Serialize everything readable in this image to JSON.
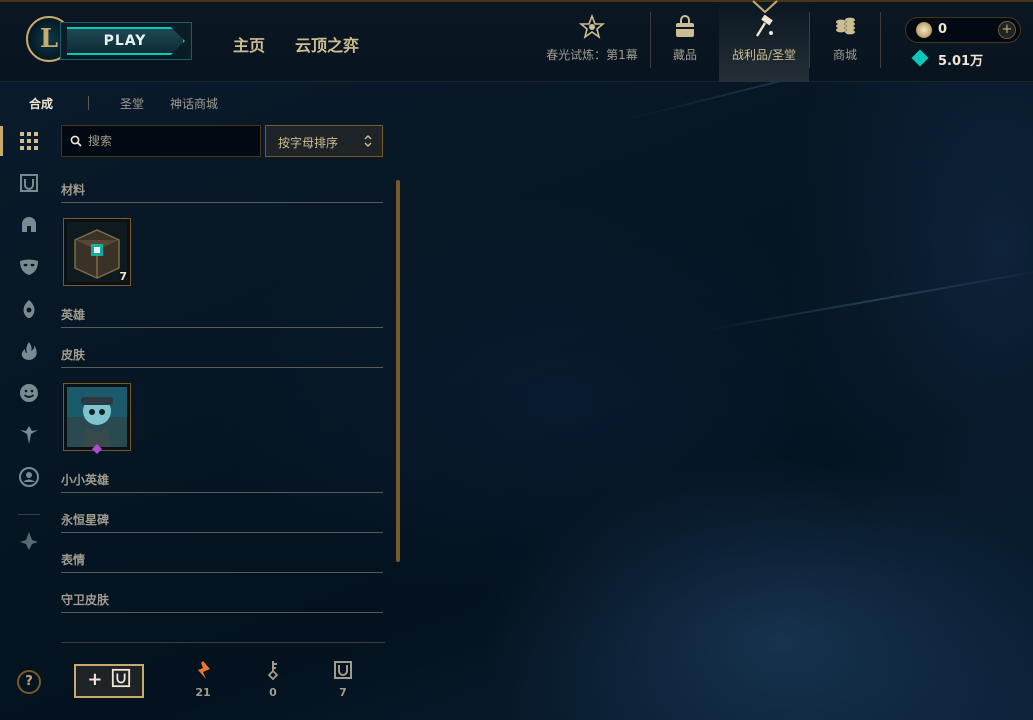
{
  "header": {
    "logo_letter": "L",
    "play_label": "PLAY",
    "nav_main": [
      {
        "label": "主页"
      },
      {
        "label": "云顶之弈"
      }
    ],
    "nav_icons": [
      {
        "label": "春光试炼：第1幕",
        "icon": "event-pass-icon"
      },
      {
        "label": "藏品",
        "icon": "collection-bag-icon"
      },
      {
        "label": "战利品/圣堂",
        "icon": "loot-hammer-icon",
        "active": true
      },
      {
        "label": "商城",
        "icon": "store-coins-icon"
      }
    ],
    "currency": {
      "rp_value": "0",
      "be_value": "5.01万",
      "plus_label": "+"
    }
  },
  "subtabs": [
    {
      "label": "合成",
      "active": true
    },
    {
      "label": "圣堂",
      "active": false
    },
    {
      "label": "神话商城",
      "active": false
    }
  ],
  "rail_icons": [
    "grid-icon",
    "chest-icon",
    "helmet-icon",
    "mask-icon",
    "ward-icon",
    "flame-icon",
    "emote-icon",
    "bird-icon",
    "profile-icon",
    "gem-icon"
  ],
  "search": {
    "placeholder": "搜索"
  },
  "sort": {
    "label": "按字母排序"
  },
  "sections": [
    {
      "title": "材料",
      "items": [
        {
          "name": "hextech-chest",
          "count": "7"
        }
      ]
    },
    {
      "title": "英雄",
      "items": []
    },
    {
      "title": "皮肤",
      "items": [
        {
          "name": "skin-shard",
          "count": ""
        }
      ]
    },
    {
      "title": "小小英雄",
      "items": []
    },
    {
      "title": "永恒星碑",
      "items": []
    },
    {
      "title": "表情",
      "items": []
    },
    {
      "title": "守卫皮肤",
      "items": []
    }
  ],
  "bottom": {
    "help_label": "?",
    "add_chest_label": "+",
    "resources": [
      {
        "name": "orange-essence",
        "count": "21",
        "color": "#e8762b"
      },
      {
        "name": "key",
        "count": "0",
        "color": "#a09b8c"
      },
      {
        "name": "chest",
        "count": "7",
        "color": "#a09b8c"
      }
    ]
  },
  "colors": {
    "gold": "#c8aa6e",
    "teal": "#0ac8b9",
    "background": "#010a13"
  }
}
